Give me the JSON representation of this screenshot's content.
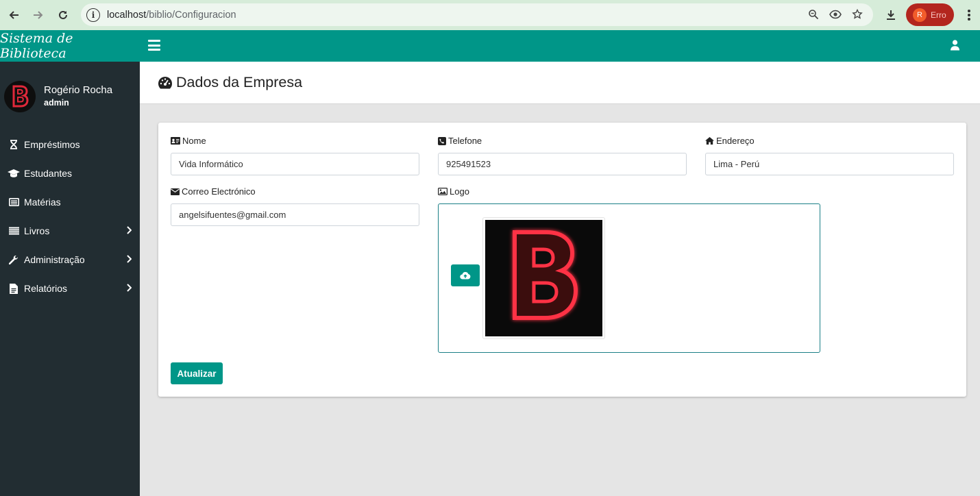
{
  "browser": {
    "url_host": "localhost",
    "url_path": "/biblio/Configuracion",
    "profile_initial": "R",
    "profile_label": "Erro"
  },
  "sidebar": {
    "brand": "Sistema de Biblioteca",
    "user": {
      "name": "Rogério Rocha",
      "role": "admin"
    },
    "items": [
      {
        "label": "Empréstimos",
        "icon": "hourglass-icon",
        "has_submenu": false
      },
      {
        "label": "Estudantes",
        "icon": "graduation-cap-icon",
        "has_submenu": false
      },
      {
        "label": "Matérias",
        "icon": "list-alt-icon",
        "has_submenu": false
      },
      {
        "label": "Livros",
        "icon": "list-icon",
        "has_submenu": true
      },
      {
        "label": "Administração",
        "icon": "wrench-icon",
        "has_submenu": true
      },
      {
        "label": "Relatórios",
        "icon": "file-icon",
        "has_submenu": true
      }
    ]
  },
  "header": {
    "title": "Dados da Empresa"
  },
  "form": {
    "nome": {
      "label": "Nome",
      "value": "Vida Informático"
    },
    "telefone": {
      "label": "Telefone",
      "value": "925491523"
    },
    "endereco": {
      "label": "Endereço",
      "value": "Lima - Perú"
    },
    "correo": {
      "label": "Correo Electrónico",
      "value": "angelsifuentes@gmail.com"
    },
    "logo": {
      "label": "Logo"
    },
    "submit_label": "Atualizar"
  },
  "colors": {
    "accent": "#009688",
    "sidebar_bg": "#222d32",
    "logo_red": "#e0283a"
  }
}
